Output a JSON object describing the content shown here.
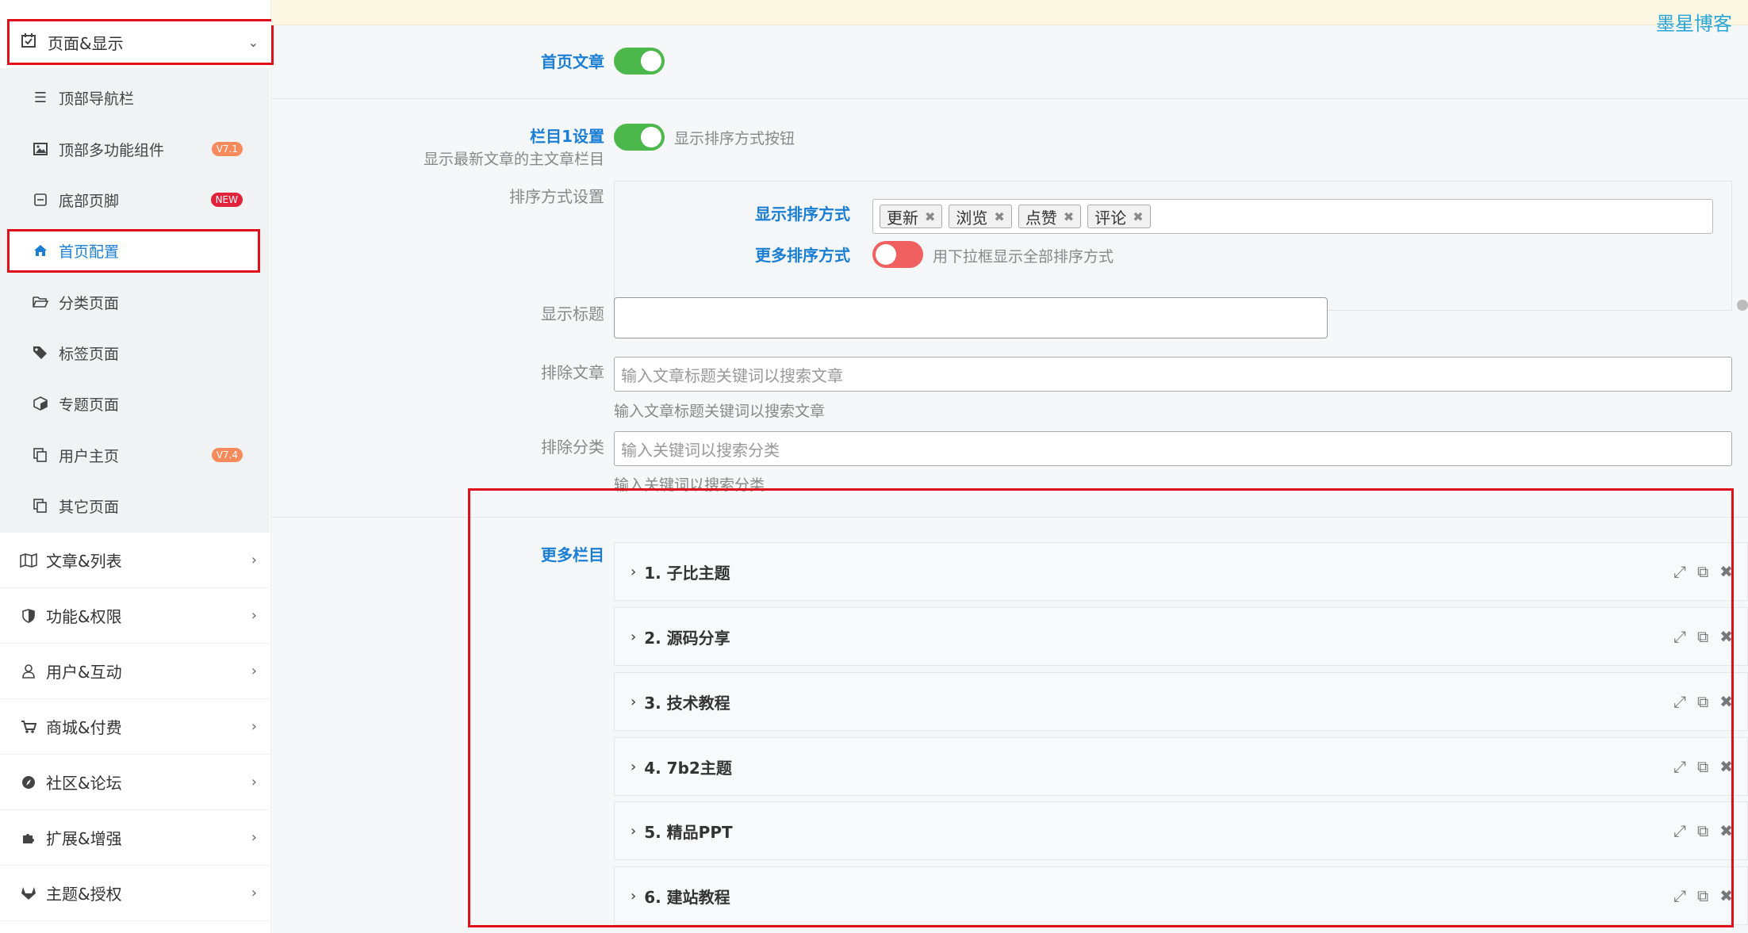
{
  "watermark": "墨星博客",
  "sidebar": {
    "top_item": {
      "label": "页面&显示",
      "icon": "calendar-check-icon"
    },
    "sub_items": [
      {
        "label": "顶部导航栏",
        "icon": "bars-icon",
        "badge": ""
      },
      {
        "label": "顶部多功能组件",
        "icon": "image-icon",
        "badge": "V7.1",
        "badge_color": "#f78a5b"
      },
      {
        "label": "底部页脚",
        "icon": "minus-square-icon",
        "badge": "NEW",
        "badge_color": "#e2223b"
      },
      {
        "label": "首页配置",
        "icon": "home-icon",
        "badge": ""
      },
      {
        "label": "分类页面",
        "icon": "folder-open-icon",
        "badge": ""
      },
      {
        "label": "标签页面",
        "icon": "tags-icon",
        "badge": ""
      },
      {
        "label": "专题页面",
        "icon": "cube-icon",
        "badge": ""
      },
      {
        "label": "用户主页",
        "icon": "copy-icon",
        "badge": "V7.4",
        "badge_color": "#f78a5b"
      },
      {
        "label": "其它页面",
        "icon": "copy-icon",
        "badge": ""
      }
    ],
    "main_items": [
      {
        "label": "文章&列表",
        "icon": "map-icon"
      },
      {
        "label": "功能&权限",
        "icon": "shield-icon"
      },
      {
        "label": "用户&互动",
        "icon": "user-icon"
      },
      {
        "label": "商城&付费",
        "icon": "cart-icon"
      },
      {
        "label": "社区&论坛",
        "icon": "compass-icon"
      },
      {
        "label": "扩展&增强",
        "icon": "puzzle-icon"
      },
      {
        "label": "主题&授权",
        "icon": "gitlab-icon"
      }
    ]
  },
  "form": {
    "home_article": {
      "label": "首页文章",
      "enabled": true
    },
    "column1": {
      "label": "栏目1设置",
      "desc": "显示最新文章的主文章栏目",
      "toggle_label": "显示排序方式按钮",
      "enabled": true
    },
    "sort_settings": {
      "label": "排序方式设置",
      "show_label": "显示排序方式",
      "tags": [
        "更新",
        "浏览",
        "点赞",
        "评论"
      ],
      "more_label": "更多排序方式",
      "more_desc": "用下拉框显示全部排序方式",
      "more_enabled": false
    },
    "display_title": {
      "label": "显示标题",
      "value": ""
    },
    "exclude_articles": {
      "label": "排除文章",
      "placeholder": "输入文章标题关键词以搜索文章",
      "hint": "输入文章标题关键词以搜索文章"
    },
    "exclude_categories": {
      "label": "排除分类",
      "placeholder": "输入关键词以搜索分类",
      "hint": "输入关键词以搜索分类"
    },
    "more_columns": {
      "label": "更多栏目",
      "items": [
        {
          "title": "1. 子比主题"
        },
        {
          "title": "2. 源码分享"
        },
        {
          "title": "3. 技术教程"
        },
        {
          "title": "4. 7b2主题"
        },
        {
          "title": "5. 精品PPT"
        },
        {
          "title": "6. 建站教程"
        }
      ]
    }
  },
  "colors": {
    "accent": "#1a7fd4",
    "highlight": "#e0101a",
    "toggle_on": "#4cb84c",
    "toggle_off": "#f06060"
  }
}
